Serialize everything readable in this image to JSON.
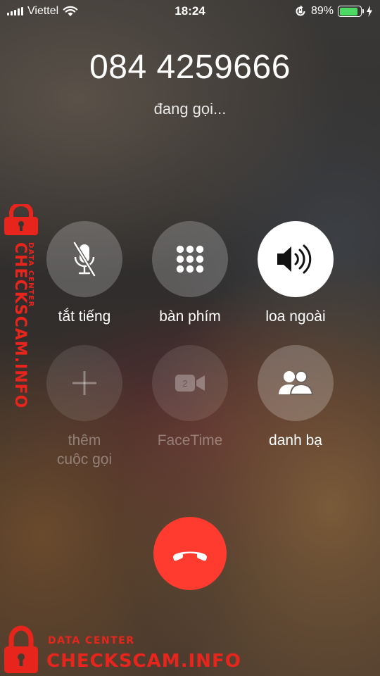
{
  "status_bar": {
    "carrier": "Viettel",
    "time": "18:24",
    "battery_percent": "89%",
    "battery_level": 0.89,
    "battery_color": "#4cd964",
    "icons": [
      "signal-icon",
      "wifi-icon",
      "rotation-lock-icon",
      "battery-icon",
      "charging-icon"
    ]
  },
  "call": {
    "number": "084 4259666",
    "status": "đang gọi..."
  },
  "controls": {
    "mute": {
      "label": "tắt tiếng",
      "icon": "mic-muted-icon"
    },
    "keypad": {
      "label": "bàn phím",
      "icon": "keypad-icon"
    },
    "speaker": {
      "label": "loa ngoài",
      "icon": "speaker-icon",
      "active": true
    },
    "add_call": {
      "label_line1": "thêm",
      "label_line2": "cuộc gọi",
      "icon": "plus-icon",
      "enabled": false
    },
    "facetime": {
      "label": "FaceTime",
      "icon": "video-camera-icon",
      "enabled": false
    },
    "contacts": {
      "label": "danh bạ",
      "icon": "contacts-icon"
    }
  },
  "end_call": {
    "icon": "phone-hangup-icon",
    "color": "#ff3b30"
  },
  "watermark": {
    "brand": "CHECKSCAM.INFO",
    "tagline": "DATA CENTER",
    "color": "#e8251c",
    "icon": "padlock-icon"
  }
}
